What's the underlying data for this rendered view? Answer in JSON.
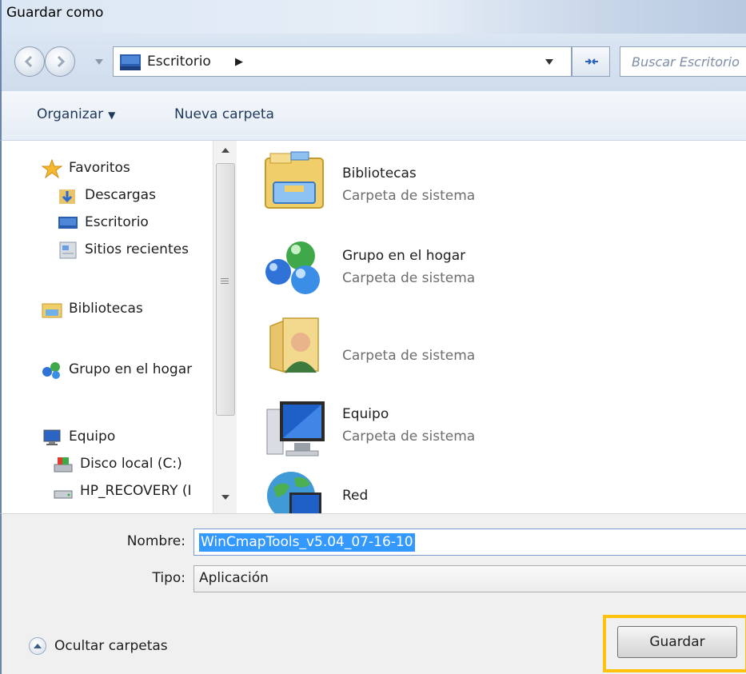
{
  "window": {
    "title": "Guardar como"
  },
  "address": {
    "location": "Escritorio",
    "search_placeholder": "Buscar Escritorio"
  },
  "toolbar": {
    "organize_label": "Organizar",
    "new_folder_label": "Nueva carpeta"
  },
  "nav": {
    "favorites": "Favoritos",
    "downloads": "Descargas",
    "desktop": "Escritorio",
    "recent": "Sitios recientes",
    "libraries": "Bibliotecas",
    "homegroup": "Grupo en el hogar",
    "computer": "Equipo",
    "local_disk": "Disco local (C:)",
    "recovery": "HP_RECOVERY (I"
  },
  "files": [
    {
      "name": "Bibliotecas",
      "type": "Carpeta de sistema",
      "icon": "libraries-icon"
    },
    {
      "name": "Grupo en el hogar",
      "type": "Carpeta de sistema",
      "icon": "homegroup-icon"
    },
    {
      "name": "",
      "type": "Carpeta de sistema",
      "icon": "user-folder-icon"
    },
    {
      "name": "Equipo",
      "type": "Carpeta de sistema",
      "icon": "computer-icon"
    },
    {
      "name": "Red",
      "type": "",
      "icon": "network-icon"
    }
  ],
  "form": {
    "name_label": "Nombre:",
    "name_value": "WinCmapTools_v5.04_07-16-10",
    "type_label": "Tipo:",
    "type_value": "Aplicación"
  },
  "footer": {
    "hide_folders_label": "Ocultar carpetas",
    "save_label": "Guardar"
  },
  "colors": {
    "selection": "#3399ff",
    "highlight": "#ffc20e"
  }
}
